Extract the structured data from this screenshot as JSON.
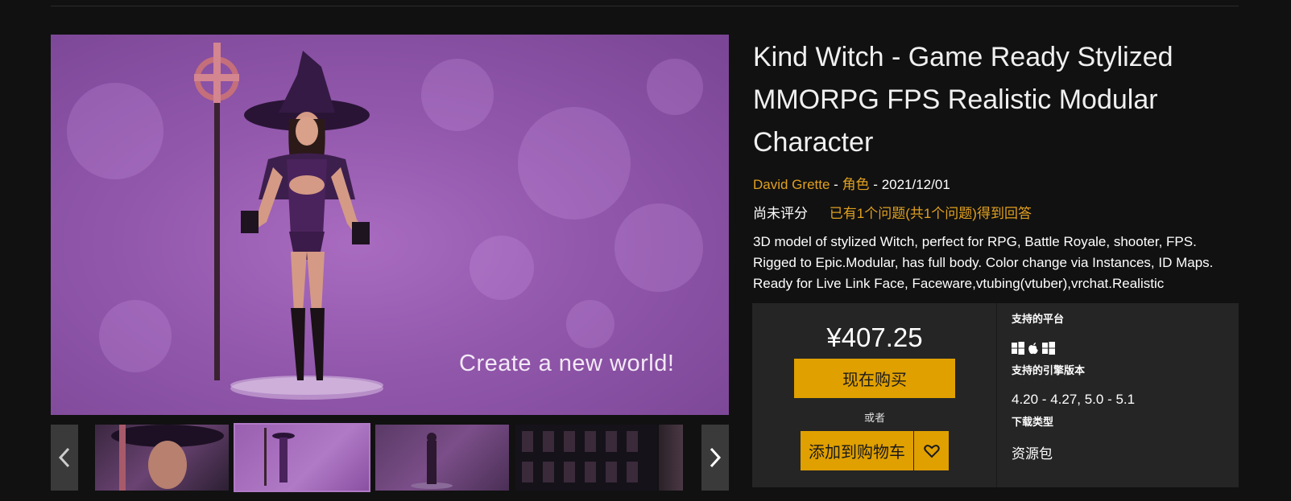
{
  "gallery": {
    "hero_caption": "Create a new world!",
    "prev_icon": "chevron-left-icon",
    "next_icon": "chevron-right-icon"
  },
  "product": {
    "title": "Kind Witch - Game Ready Stylized MMORPG FPS Realistic Modular Character",
    "author": "David Grette",
    "category": "角色",
    "date": "2021/12/01",
    "rating_status": "尚未评分",
    "qa_summary": "已有1个问题(共1个问题)得到回答",
    "description": "3D model of stylized Witch, perfect for RPG, Battle Royale, shooter, FPS. Rigged to Epic.Modular, has full body. Color change via Instances, ID Maps. Ready for Live Link Face, Faceware,vtubing(vtuber),vrchat.Realistic"
  },
  "purchase": {
    "price": "¥407.25",
    "buy_now_label": "现在购买",
    "or_label": "或者",
    "add_to_cart_label": "添加到购物车",
    "wishlist_icon": "heart-icon"
  },
  "specs": {
    "platforms_label": "支持的平台",
    "platform_icons": [
      "windows-icon",
      "apple-icon",
      "windows-icon"
    ],
    "engine_label": "支持的引擎版本",
    "engine_versions": "4.20 - 4.27, 5.0 - 5.1",
    "download_label": "下载类型",
    "download_type": "资源包"
  },
  "colors": {
    "background": "#111111",
    "accent": "#e0a000",
    "link": "#e0a020",
    "panel": "#252525"
  }
}
